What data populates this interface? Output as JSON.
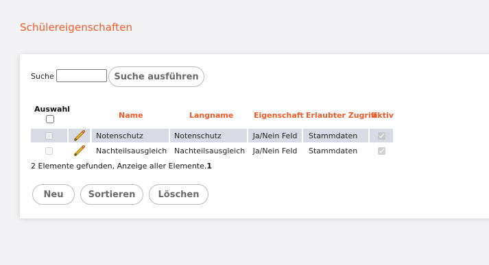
{
  "page": {
    "title": "Schülereigenschaften"
  },
  "search": {
    "label": "Suche",
    "value": "",
    "button_label": "Suche ausführen"
  },
  "table": {
    "headers": {
      "select": "Auswahl",
      "name": "Name",
      "langname": "Langname",
      "eigenschaft": "Eigenschaft",
      "zugriff": "Erlaubter Zugriff",
      "aktiv": "aktiv"
    },
    "rows": [
      {
        "name": "Notenschutz",
        "langname": "Notenschutz",
        "eigenschaft": "Ja/Nein Feld",
        "zugriff": "Stammdaten",
        "aktiv": true,
        "selected": false
      },
      {
        "name": "Nachteilsausgleich",
        "langname": "Nachteilsausgleich",
        "eigenschaft": "Ja/Nein Feld",
        "zugriff": "Stammdaten",
        "aktiv": true,
        "selected": false
      }
    ]
  },
  "result": {
    "text": "2 Elemente gefunden, Anzeige aller Elemente.",
    "page": "1"
  },
  "buttons": {
    "new": "Neu",
    "sort": "Sortieren",
    "delete": "Löschen"
  },
  "colors": {
    "accent": "#f05a28",
    "row_highlight": "#d8dbe3",
    "background": "#f3f3f5"
  },
  "icons": {
    "edit": "pencil-icon"
  }
}
